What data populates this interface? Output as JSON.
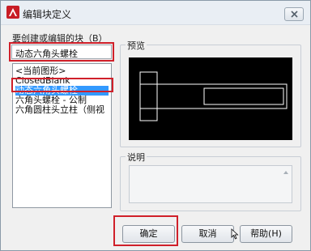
{
  "window": {
    "title": "编辑块定义"
  },
  "block_select": {
    "label": "要创建或编辑的块（B）",
    "value": "动态六角头螺栓"
  },
  "block_list": {
    "items": [
      {
        "label": "<当前图形>",
        "selected": false
      },
      {
        "label": "ClosedBlank",
        "selected": false
      },
      {
        "label": "动态六角头螺栓",
        "selected": true
      },
      {
        "label": "六角头螺栓 - 公制",
        "selected": false
      },
      {
        "label": "六角圆柱头立柱（侧视",
        "selected": false
      }
    ]
  },
  "preview": {
    "label": "预览"
  },
  "description": {
    "label": "说明"
  },
  "buttons": {
    "ok": "确定",
    "cancel": "取消",
    "help": "帮助(H)"
  },
  "colors": {
    "selection": "#3399ff",
    "highlight_box": "#d0202a",
    "preview_bg": "#000000",
    "preview_lines": "#ffffff",
    "app_icon": "#c81d25"
  },
  "icons": {
    "app": "autocad-logo-icon",
    "close": "close-icon"
  }
}
